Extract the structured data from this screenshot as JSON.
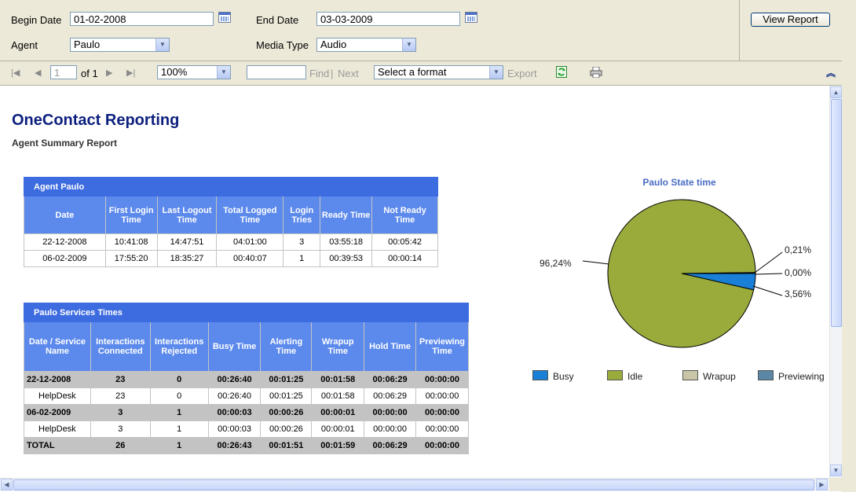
{
  "params": {
    "begin_date_label": "Begin Date",
    "begin_date_value": "01-02-2008",
    "end_date_label": "End Date",
    "end_date_value": "03-03-2009",
    "agent_label": "Agent",
    "agent_value": "Paulo",
    "media_type_label": "Media Type",
    "media_type_value": "Audio",
    "view_report_label": "View Report"
  },
  "toolbar": {
    "page_value": "1",
    "of_label": "of 1",
    "zoom_value": "100%",
    "find_label": "Find",
    "separator": "|",
    "next_label": "Next",
    "format_value": "Select a format",
    "export_label": "Export"
  },
  "report": {
    "title": "OneContact Reporting",
    "subtitle": "Agent Summary Report",
    "agent_table": {
      "caption": "Agent Paulo",
      "headers": [
        "Date",
        "First Login Time",
        "Last Logout Time",
        "Total Logged Time",
        "Login Tries",
        "Ready Time",
        "Not Ready Time"
      ],
      "rows": [
        [
          "22-12-2008",
          "10:41:08",
          "14:47:51",
          "04:01:00",
          "3",
          "03:55:18",
          "00:05:42"
        ],
        [
          "06-02-2009",
          "17:55:20",
          "18:35:27",
          "00:40:07",
          "1",
          "00:39:53",
          "00:00:14"
        ]
      ]
    },
    "services_table": {
      "caption": "Paulo Services Times",
      "headers": [
        "Date / Service Name",
        "Interactions Connected",
        "Interactions Rejected",
        "Busy Time",
        "Alerting Time",
        "Wrapup Time",
        "Hold Time",
        "Previewing Time"
      ],
      "rows": [
        [
          "22-12-2008",
          "23",
          "0",
          "00:26:40",
          "00:01:25",
          "00:01:58",
          "00:06:29",
          "00:00:00"
        ],
        [
          "HelpDesk",
          "23",
          "0",
          "00:26:40",
          "00:01:25",
          "00:01:58",
          "00:06:29",
          "00:00:00"
        ],
        [
          "06-02-2009",
          "3",
          "1",
          "00:00:03",
          "00:00:26",
          "00:00:01",
          "00:00:00",
          "00:00:00"
        ],
        [
          "HelpDesk",
          "3",
          "1",
          "00:00:03",
          "00:00:26",
          "00:00:01",
          "00:00:00",
          "00:00:00"
        ],
        [
          "TOTAL",
          "26",
          "1",
          "00:26:43",
          "00:01:51",
          "00:01:59",
          "00:06:29",
          "00:00:00"
        ]
      ]
    }
  },
  "chart_data": {
    "type": "pie",
    "title": "Paulo State time",
    "slices": [
      {
        "name": "Idle",
        "value": 96.24,
        "label": "96,24%",
        "color": "#9aab3c"
      },
      {
        "name": "Previewing",
        "value": 0.21,
        "label": "0,21%",
        "color": "#5b87a6"
      },
      {
        "name": "Wrapup",
        "value": 0.0,
        "label": "0,00%",
        "color": "#c9c6a8"
      },
      {
        "name": "Busy",
        "value": 3.56,
        "label": "3,56%",
        "color": "#1a7fd6"
      }
    ],
    "legend": [
      "Busy",
      "Idle",
      "Wrapup",
      "Previewing"
    ],
    "legend_placement": "bottom"
  }
}
